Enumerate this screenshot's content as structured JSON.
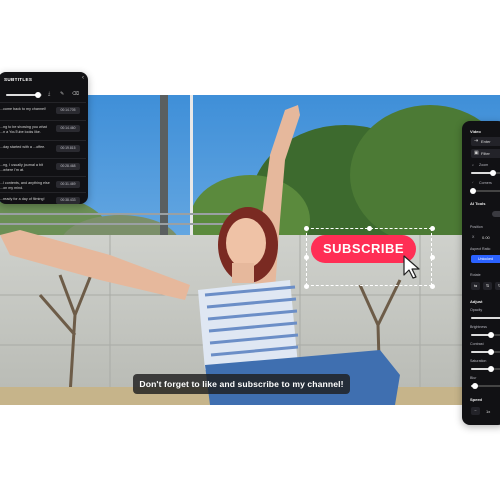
{
  "video": {
    "caption": "Don't forget to like and subscribe to my channel!",
    "subscribe_label": "SUBSCRIBE"
  },
  "subtitles_panel": {
    "title": "SUBTITLES",
    "close_icon": "chevron-left-icon",
    "toolbar_icons": [
      "download-icon",
      "edit-icon",
      "delete-icon"
    ],
    "rows": [
      {
        "text": "...come back to my channel!",
        "time": "00:14.705"
      },
      {
        "text": "...ng to be showing you what ...n a YouTube looks like.",
        "time": "00:14.460"
      },
      {
        "text": "...day started with a ...offee.",
        "time": "00:19.815"
      },
      {
        "text": "...ng, I usually journal a bit ...where I'm at.",
        "time": "00:28.468"
      },
      {
        "text": "...l contents, and anything else ...on my mind.",
        "time": "00:31.469"
      },
      {
        "text": "...ready for a day of filming!",
        "time": "00:38.433"
      }
    ]
  },
  "properties_panel": {
    "video_heading": "Video",
    "enter_label": "Enter",
    "filter_label": "Filter",
    "zoom_label": "Zoom",
    "corners_label": "Corners",
    "ai_tools_heading": "AI Tools",
    "position_label": "Position",
    "position_x_label": "X",
    "position_x_value": "0.00",
    "aspect_ratio_label": "Aspect Ratio",
    "aspect_ratio_value": "Unlocked",
    "rotate_label": "Rotate",
    "adjust_heading": "Adjust",
    "opacity_label": "Opacity",
    "brightness_label": "Brightness",
    "contrast_label": "Contrast",
    "saturation_label": "Saturation",
    "blur_label": "Blur",
    "speed_label": "Speed",
    "speed_value": "1x",
    "speed_minus": "−",
    "accent_color": "#2b62ff",
    "levels": {
      "zoom": 0.55,
      "opacity": 0.9,
      "brightness": 0.5,
      "contrast": 0.5,
      "saturation": 0.5,
      "blur": 0.1
    }
  },
  "colors": {
    "subscribe": "#ff2e55",
    "panel_bg": "#111114"
  }
}
